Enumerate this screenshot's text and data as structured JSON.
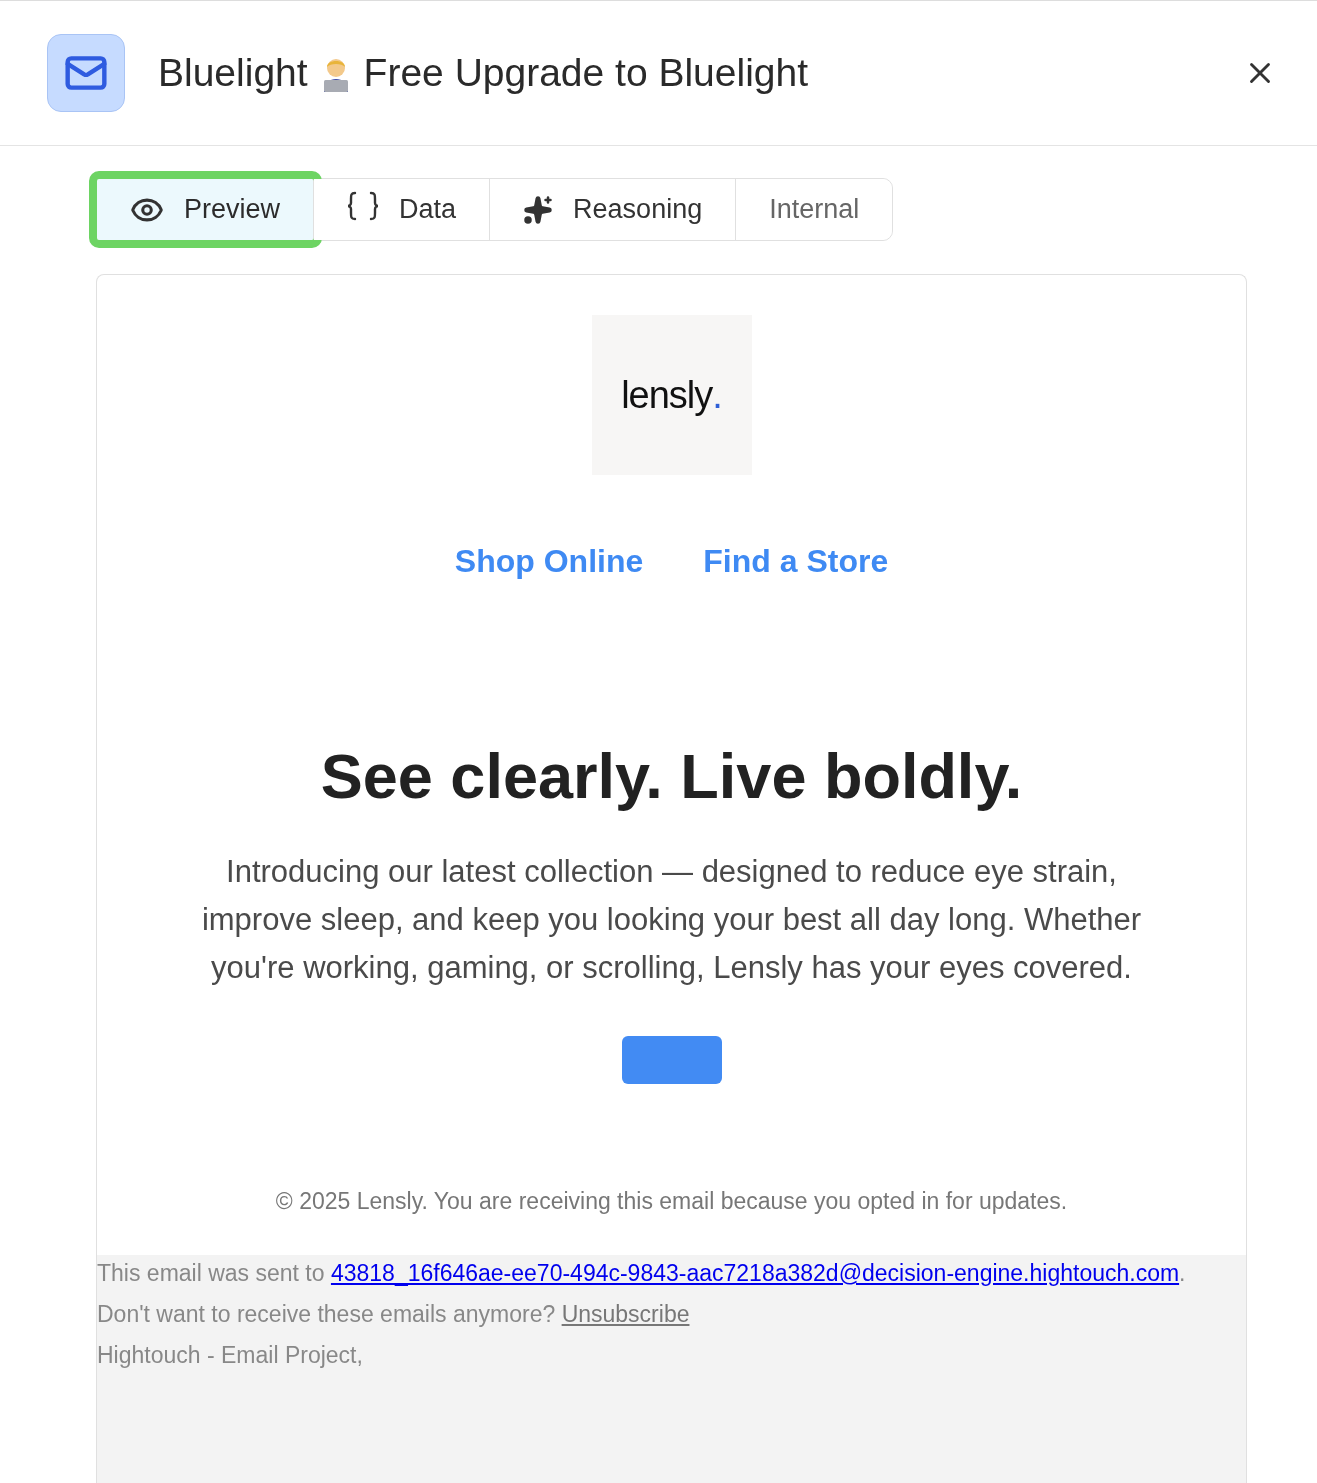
{
  "header": {
    "title_parts": [
      "Bluelight",
      "Free Upgrade to Bluelight"
    ]
  },
  "tabs": [
    {
      "label": "Preview",
      "kind": "eye",
      "selected": true,
      "highlighted": true
    },
    {
      "label": "Data",
      "kind": "braces",
      "selected": false,
      "highlighted": false
    },
    {
      "label": "Reasoning",
      "kind": "sparkles",
      "selected": false,
      "highlighted": false
    },
    {
      "label": "Internal",
      "kind": "plain",
      "selected": false,
      "highlighted": false
    }
  ],
  "email": {
    "logo": {
      "word": "lensly",
      "dot": "."
    },
    "nav_links": [
      "Shop Online",
      "Find a Store"
    ],
    "headline": "See clearly. Live boldly.",
    "body": "Introducing our latest collection — designed to reduce eye strain, improve sleep, and keep you looking your best all day long. Whether you're working, gaming, or scrolling, Lensly has your eyes covered.",
    "footer_note": "© 2025 Lensly. You are receiving this email because you opted in for updates."
  },
  "system_footer": {
    "sent_to_prefix": "This email was sent to ",
    "address": "43818_16f646ae-ee70-494c-9843-aac7218a382d@decision-engine.hightouch.com",
    "sent_to_suffix": ".",
    "unsubscribe_prefix": "Don't want to receive these emails anymore? ",
    "unsubscribe_link": "Unsubscribe",
    "sender": "Hightouch - Email Project,"
  }
}
